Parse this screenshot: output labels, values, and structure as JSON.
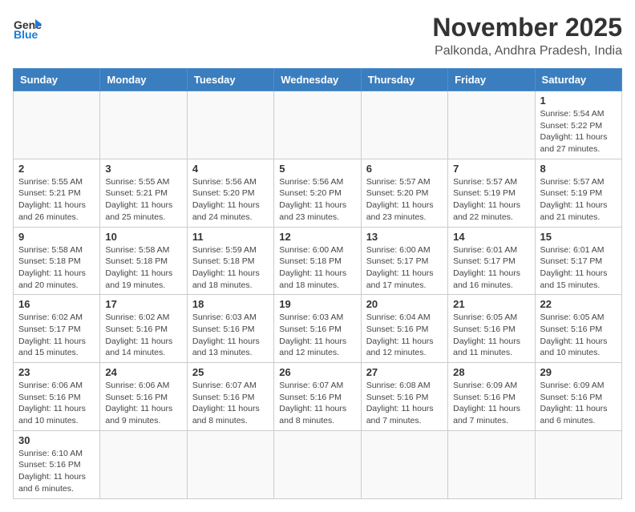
{
  "header": {
    "logo_general": "General",
    "logo_blue": "Blue",
    "month": "November 2025",
    "location": "Palkonda, Andhra Pradesh, India"
  },
  "weekdays": [
    "Sunday",
    "Monday",
    "Tuesday",
    "Wednesday",
    "Thursday",
    "Friday",
    "Saturday"
  ],
  "weeks": [
    [
      {
        "day": "",
        "info": ""
      },
      {
        "day": "",
        "info": ""
      },
      {
        "day": "",
        "info": ""
      },
      {
        "day": "",
        "info": ""
      },
      {
        "day": "",
        "info": ""
      },
      {
        "day": "",
        "info": ""
      },
      {
        "day": "1",
        "info": "Sunrise: 5:54 AM\nSunset: 5:22 PM\nDaylight: 11 hours\nand 27 minutes."
      }
    ],
    [
      {
        "day": "2",
        "info": "Sunrise: 5:55 AM\nSunset: 5:21 PM\nDaylight: 11 hours\nand 26 minutes."
      },
      {
        "day": "3",
        "info": "Sunrise: 5:55 AM\nSunset: 5:21 PM\nDaylight: 11 hours\nand 25 minutes."
      },
      {
        "day": "4",
        "info": "Sunrise: 5:56 AM\nSunset: 5:20 PM\nDaylight: 11 hours\nand 24 minutes."
      },
      {
        "day": "5",
        "info": "Sunrise: 5:56 AM\nSunset: 5:20 PM\nDaylight: 11 hours\nand 23 minutes."
      },
      {
        "day": "6",
        "info": "Sunrise: 5:57 AM\nSunset: 5:20 PM\nDaylight: 11 hours\nand 23 minutes."
      },
      {
        "day": "7",
        "info": "Sunrise: 5:57 AM\nSunset: 5:19 PM\nDaylight: 11 hours\nand 22 minutes."
      },
      {
        "day": "8",
        "info": "Sunrise: 5:57 AM\nSunset: 5:19 PM\nDaylight: 11 hours\nand 21 minutes."
      }
    ],
    [
      {
        "day": "9",
        "info": "Sunrise: 5:58 AM\nSunset: 5:18 PM\nDaylight: 11 hours\nand 20 minutes."
      },
      {
        "day": "10",
        "info": "Sunrise: 5:58 AM\nSunset: 5:18 PM\nDaylight: 11 hours\nand 19 minutes."
      },
      {
        "day": "11",
        "info": "Sunrise: 5:59 AM\nSunset: 5:18 PM\nDaylight: 11 hours\nand 18 minutes."
      },
      {
        "day": "12",
        "info": "Sunrise: 6:00 AM\nSunset: 5:18 PM\nDaylight: 11 hours\nand 18 minutes."
      },
      {
        "day": "13",
        "info": "Sunrise: 6:00 AM\nSunset: 5:17 PM\nDaylight: 11 hours\nand 17 minutes."
      },
      {
        "day": "14",
        "info": "Sunrise: 6:01 AM\nSunset: 5:17 PM\nDaylight: 11 hours\nand 16 minutes."
      },
      {
        "day": "15",
        "info": "Sunrise: 6:01 AM\nSunset: 5:17 PM\nDaylight: 11 hours\nand 15 minutes."
      }
    ],
    [
      {
        "day": "16",
        "info": "Sunrise: 6:02 AM\nSunset: 5:17 PM\nDaylight: 11 hours\nand 15 minutes."
      },
      {
        "day": "17",
        "info": "Sunrise: 6:02 AM\nSunset: 5:16 PM\nDaylight: 11 hours\nand 14 minutes."
      },
      {
        "day": "18",
        "info": "Sunrise: 6:03 AM\nSunset: 5:16 PM\nDaylight: 11 hours\nand 13 minutes."
      },
      {
        "day": "19",
        "info": "Sunrise: 6:03 AM\nSunset: 5:16 PM\nDaylight: 11 hours\nand 12 minutes."
      },
      {
        "day": "20",
        "info": "Sunrise: 6:04 AM\nSunset: 5:16 PM\nDaylight: 11 hours\nand 12 minutes."
      },
      {
        "day": "21",
        "info": "Sunrise: 6:05 AM\nSunset: 5:16 PM\nDaylight: 11 hours\nand 11 minutes."
      },
      {
        "day": "22",
        "info": "Sunrise: 6:05 AM\nSunset: 5:16 PM\nDaylight: 11 hours\nand 10 minutes."
      }
    ],
    [
      {
        "day": "23",
        "info": "Sunrise: 6:06 AM\nSunset: 5:16 PM\nDaylight: 11 hours\nand 10 minutes."
      },
      {
        "day": "24",
        "info": "Sunrise: 6:06 AM\nSunset: 5:16 PM\nDaylight: 11 hours\nand 9 minutes."
      },
      {
        "day": "25",
        "info": "Sunrise: 6:07 AM\nSunset: 5:16 PM\nDaylight: 11 hours\nand 8 minutes."
      },
      {
        "day": "26",
        "info": "Sunrise: 6:07 AM\nSunset: 5:16 PM\nDaylight: 11 hours\nand 8 minutes."
      },
      {
        "day": "27",
        "info": "Sunrise: 6:08 AM\nSunset: 5:16 PM\nDaylight: 11 hours\nand 7 minutes."
      },
      {
        "day": "28",
        "info": "Sunrise: 6:09 AM\nSunset: 5:16 PM\nDaylight: 11 hours\nand 7 minutes."
      },
      {
        "day": "29",
        "info": "Sunrise: 6:09 AM\nSunset: 5:16 PM\nDaylight: 11 hours\nand 6 minutes."
      }
    ],
    [
      {
        "day": "30",
        "info": "Sunrise: 6:10 AM\nSunset: 5:16 PM\nDaylight: 11 hours\nand 6 minutes."
      },
      {
        "day": "",
        "info": ""
      },
      {
        "day": "",
        "info": ""
      },
      {
        "day": "",
        "info": ""
      },
      {
        "day": "",
        "info": ""
      },
      {
        "day": "",
        "info": ""
      },
      {
        "day": "",
        "info": ""
      }
    ]
  ]
}
